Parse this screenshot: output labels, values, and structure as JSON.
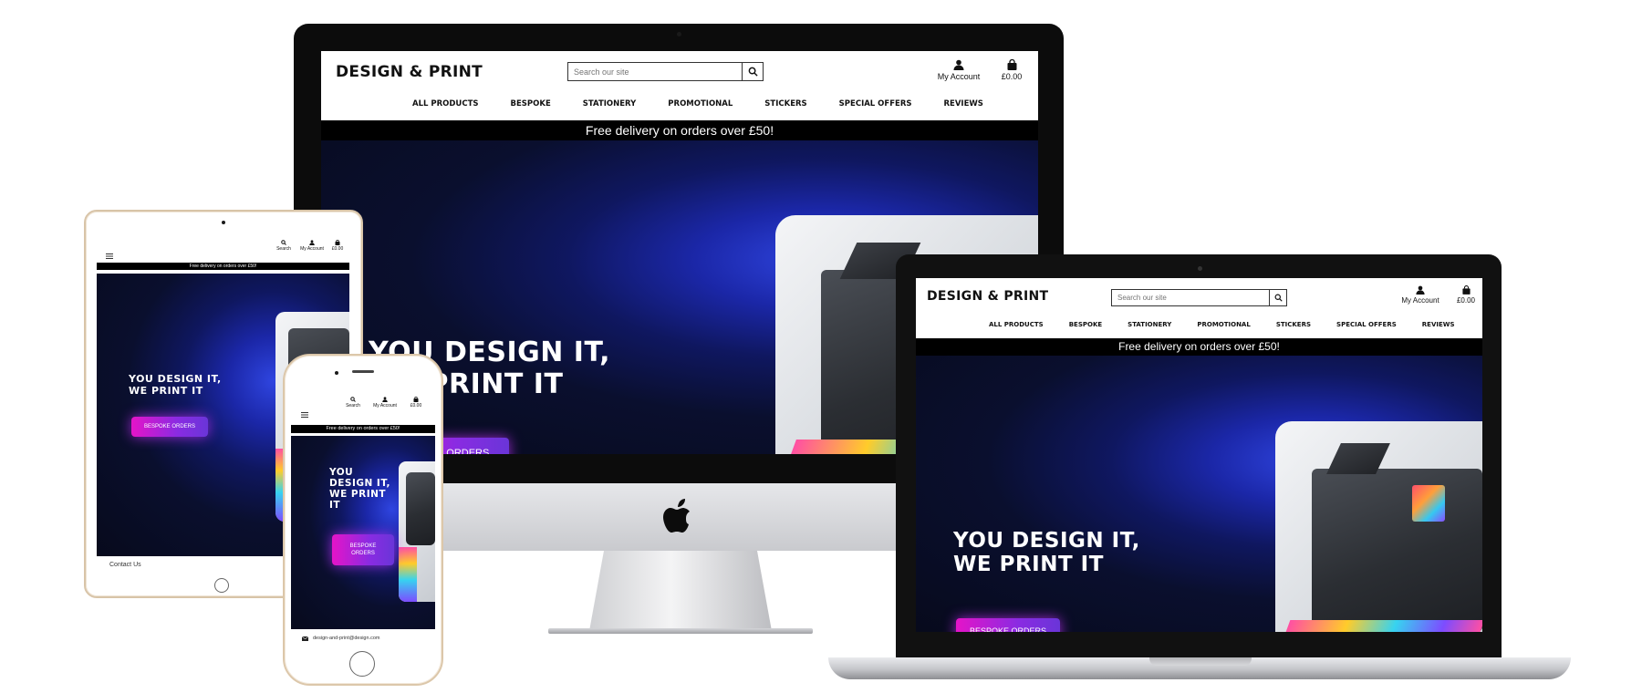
{
  "site": {
    "logo": "DESIGN & PRINT",
    "search_placeholder": "Search our site",
    "account_label": "My Account",
    "cart_total": "£0.00",
    "search_label": "Search",
    "nav_items": [
      "ALL PRODUCTS",
      "BESPOKE",
      "STATIONERY",
      "PROMOTIONAL",
      "STICKERS",
      "SPECIAL OFFERS",
      "REVIEWS"
    ],
    "promo_banner": "Free delivery on orders over £50!",
    "hero_title_line1": "YOU DESIGN IT,",
    "hero_title_line2": "WE PRINT IT",
    "cta_label": "BESPOKE ORDERS",
    "footer_contact": "Contact Us",
    "footer_email": "design-and-print@design.com"
  },
  "icons": {
    "search": "magnifier",
    "account": "person",
    "cart": "shopping-bag",
    "menu": "hamburger",
    "email": "envelope",
    "apple_logo": "apple"
  },
  "colors": {
    "promo_bg": "#000000",
    "hero_dark": "#0a0f2e",
    "hero_glow": "#2f45e0",
    "cta_start": "#e514c8",
    "cta_end": "#6a35d8"
  }
}
